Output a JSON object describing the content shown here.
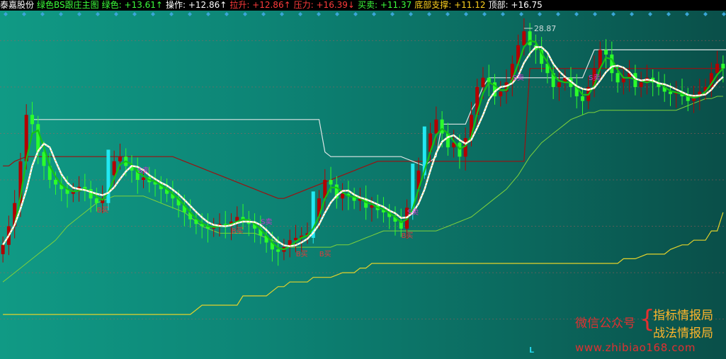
{
  "header": {
    "stock_name": "泰嘉股份",
    "indicator_name": "绿色BS跟庄主图",
    "readouts": [
      {
        "label": "绿色:",
        "value": "+13.61",
        "arrow": "↑",
        "color": "#3cff3c"
      },
      {
        "label": "操作:",
        "value": "+12.86",
        "arrow": "↑",
        "color": "#ffffff"
      },
      {
        "label": "拉升:",
        "value": "+12.86",
        "arrow": "↑",
        "color": "#ff3b3b"
      },
      {
        "label": "压力:",
        "value": "+16.39",
        "arrow": "↓",
        "color": "#ff3b3b"
      },
      {
        "label": "买卖:",
        "value": "+11.37",
        "arrow": "",
        "color": "#3cff3c"
      },
      {
        "label": "底部支撑:",
        "value": "+11.12",
        "arrow": "",
        "color": "#ffd21e"
      },
      {
        "label": "顶部:",
        "value": "+16.75",
        "arrow": "",
        "color": "#ffffff"
      }
    ]
  },
  "chart_data": {
    "type": "candlestick",
    "ylim": [
      10.4,
      17.6
    ],
    "grid": true,
    "max_annotation": "28.87",
    "colors": {
      "up_bar": "#b30000",
      "down_bar": "#2bff2b",
      "signal_bar": "#22e8f2",
      "pressure": "#9a1111",
      "top": "#dfe6e6",
      "support": "#e3d22b",
      "lower_band": "#7fd13b",
      "ma_white": "#ffffff",
      "ma_green": "#16c216",
      "signal_label": "#e03b3b",
      "sell_label": "#cc33cc"
    },
    "closes": [
      12.6,
      13.0,
      13.5,
      14.4,
      15.4,
      15.2,
      14.6,
      14.3,
      14.0,
      13.9,
      13.8,
      13.7,
      13.75,
      13.85,
      13.8,
      13.6,
      13.5,
      13.6,
      14.1,
      14.4,
      14.5,
      14.3,
      14.2,
      14.0,
      14.05,
      13.95,
      13.9,
      13.8,
      13.7,
      13.6,
      13.45,
      13.3,
      13.15,
      13.05,
      13.0,
      12.95,
      13.0,
      13.05,
      13.0,
      13.1,
      13.2,
      13.15,
      13.05,
      12.95,
      12.8,
      12.65,
      12.5,
      12.45,
      12.55,
      12.7,
      12.75,
      12.8,
      12.85,
      13.2,
      13.6,
      14.0,
      13.9,
      13.6,
      13.7,
      13.65,
      13.55,
      13.6,
      13.4,
      13.45,
      13.35,
      13.3,
      13.2,
      13.1,
      12.95,
      13.4,
      13.8,
      14.2,
      14.6,
      15.0,
      15.3,
      15.0,
      14.7,
      14.8,
      14.5,
      14.9,
      15.4,
      16.0,
      16.2,
      16.1,
      15.8,
      15.9,
      16.1,
      16.5,
      16.9,
      17.2,
      16.9,
      16.8,
      16.5,
      16.3,
      16.0,
      16.1,
      16.2,
      16.0,
      15.8,
      15.7,
      16.0,
      16.4,
      16.8,
      16.7,
      16.3,
      16.1,
      16.2,
      16.3,
      16.0,
      16.1,
      16.2,
      16.1,
      16.0,
      15.9,
      15.85,
      15.9,
      15.8,
      15.7,
      15.8,
      15.9,
      16.0,
      16.3,
      16.5,
      16.4
    ],
    "pressure": [
      14.3,
      14.3,
      14.4,
      14.45,
      14.5,
      14.5,
      14.5,
      14.5,
      14.5,
      14.5,
      14.5,
      14.5,
      14.5,
      14.5,
      14.5,
      14.5,
      14.5,
      14.5,
      14.5,
      14.5,
      14.5,
      14.5,
      14.5,
      14.5,
      14.5,
      14.5,
      14.5,
      14.5,
      14.5,
      14.5,
      14.45,
      14.4,
      14.35,
      14.3,
      14.25,
      14.2,
      14.15,
      14.1,
      14.05,
      14.0,
      13.95,
      13.9,
      13.85,
      13.8,
      13.75,
      13.7,
      13.65,
      13.6,
      13.6,
      13.65,
      13.7,
      13.75,
      13.8,
      13.85,
      13.9,
      13.95,
      14.0,
      14.05,
      14.1,
      14.15,
      14.2,
      14.25,
      14.3,
      14.35,
      14.4,
      14.4,
      14.4,
      14.4,
      14.4,
      14.4,
      14.4,
      14.4,
      14.4,
      14.4,
      14.4,
      14.4,
      14.4,
      14.4,
      14.4,
      14.4,
      14.4,
      14.4,
      14.4,
      14.4,
      14.4,
      14.4,
      14.4,
      14.4,
      14.4,
      14.4,
      16.4,
      16.4,
      16.4,
      16.4,
      16.4,
      16.4,
      16.4,
      16.4,
      16.4,
      16.4,
      16.4,
      16.4,
      16.4,
      16.4,
      16.4,
      16.4,
      16.4,
      16.4,
      16.4,
      16.4,
      16.4,
      16.4,
      16.4,
      16.4,
      16.4,
      16.4,
      16.4,
      16.4,
      16.4,
      16.4,
      16.4,
      16.4,
      16.4,
      16.4
    ],
    "top": [
      null,
      null,
      null,
      null,
      null,
      15.3,
      15.3,
      15.3,
      15.3,
      15.3,
      15.3,
      15.3,
      15.3,
      15.3,
      15.3,
      15.3,
      15.3,
      15.3,
      15.3,
      15.3,
      15.3,
      15.3,
      15.3,
      15.3,
      15.3,
      15.3,
      15.3,
      15.3,
      15.3,
      15.3,
      15.3,
      15.3,
      15.3,
      15.3,
      15.3,
      15.3,
      15.3,
      15.3,
      15.3,
      15.3,
      15.3,
      15.3,
      15.3,
      15.3,
      15.3,
      15.3,
      15.3,
      15.3,
      15.3,
      15.3,
      15.3,
      15.3,
      15.3,
      15.3,
      15.3,
      14.6,
      14.5,
      14.5,
      14.5,
      14.5,
      14.5,
      14.5,
      14.5,
      14.5,
      14.5,
      14.5,
      14.5,
      14.5,
      14.5,
      14.45,
      14.4,
      14.35,
      14.3,
      14.4,
      14.5,
      15.2,
      15.2,
      15.2,
      15.2,
      15.2,
      15.5,
      15.7,
      16.0,
      16.2,
      16.2,
      16.2,
      16.2,
      16.2,
      16.2,
      16.2,
      16.2,
      16.2,
      16.2,
      16.2,
      16.2,
      16.2,
      16.2,
      16.2,
      16.2,
      16.2,
      16.5,
      16.8,
      16.8,
      16.8,
      16.8,
      16.8,
      16.8,
      16.8,
      16.8,
      16.8,
      16.8,
      16.8,
      16.8,
      16.8,
      16.8,
      16.8,
      16.8,
      16.8,
      16.8,
      16.8,
      16.8,
      16.8,
      16.8,
      16.8,
      16.8,
      16.8,
      16.8,
      16.8
    ],
    "support": [
      11.1,
      11.1,
      11.1,
      11.1,
      11.1,
      11.1,
      11.1,
      11.1,
      11.1,
      11.1,
      11.1,
      11.1,
      11.1,
      11.1,
      11.1,
      11.1,
      11.1,
      11.1,
      11.1,
      11.1,
      11.1,
      11.1,
      11.1,
      11.1,
      11.1,
      11.1,
      11.1,
      11.1,
      11.1,
      11.1,
      11.1,
      11.1,
      11.1,
      11.2,
      11.3,
      11.3,
      11.3,
      11.3,
      11.3,
      11.3,
      11.3,
      11.5,
      11.5,
      11.5,
      11.5,
      11.5,
      11.6,
      11.7,
      11.7,
      11.8,
      11.8,
      11.8,
      11.8,
      11.9,
      11.9,
      11.9,
      11.9,
      11.95,
      12.0,
      12.0,
      12.0,
      12.1,
      12.1,
      12.2,
      12.2,
      12.2,
      12.2,
      12.2,
      12.2,
      12.2,
      12.2,
      12.2,
      12.2,
      12.2,
      12.2,
      12.2,
      12.2,
      12.2,
      12.2,
      12.2,
      12.2,
      12.2,
      12.2,
      12.2,
      12.2,
      12.2,
      12.2,
      12.2,
      12.2,
      12.2,
      12.2,
      12.2,
      12.2,
      12.2,
      12.2,
      12.2,
      12.2,
      12.2,
      12.2,
      12.2,
      12.2,
      12.2,
      12.2,
      12.2,
      12.2,
      12.2,
      12.3,
      12.3,
      12.3,
      12.35,
      12.4,
      12.4,
      12.4,
      12.4,
      12.5,
      12.55,
      12.6,
      12.6,
      12.7,
      12.7,
      12.7,
      12.9,
      12.9,
      13.3
    ],
    "lower_band": [
      11.8,
      11.9,
      12.0,
      12.1,
      12.2,
      12.3,
      12.4,
      12.5,
      12.6,
      12.7,
      12.85,
      13.0,
      13.1,
      13.2,
      13.3,
      13.4,
      13.5,
      13.55,
      13.6,
      13.65,
      13.65,
      13.65,
      13.65,
      13.65,
      13.65,
      13.6,
      13.55,
      13.5,
      13.45,
      13.4,
      13.35,
      13.3,
      13.2,
      13.1,
      13.0,
      12.95,
      12.9,
      12.85,
      12.85,
      12.85,
      12.85,
      12.85,
      12.85,
      12.85,
      12.8,
      12.75,
      12.7,
      12.65,
      12.6,
      12.55,
      12.55,
      12.55,
      12.55,
      12.55,
      12.55,
      12.55,
      12.55,
      12.6,
      12.6,
      12.6,
      12.65,
      12.7,
      12.75,
      12.8,
      12.85,
      12.9,
      12.9,
      12.9,
      12.9,
      12.9,
      12.9,
      12.9,
      12.9,
      12.9,
      12.9,
      12.95,
      13.0,
      13.05,
      13.1,
      13.15,
      13.2,
      13.3,
      13.4,
      13.5,
      13.6,
      13.7,
      13.8,
      13.95,
      14.1,
      14.3,
      14.5,
      14.65,
      14.8,
      14.9,
      15.0,
      15.1,
      15.2,
      15.3,
      15.35,
      15.4,
      15.45,
      15.45,
      15.5,
      15.5,
      15.5,
      15.5,
      15.5,
      15.5,
      15.5,
      15.5,
      15.5,
      15.5,
      15.5,
      15.5,
      15.5,
      15.5,
      15.55,
      15.6,
      15.65,
      15.7,
      15.75,
      15.75,
      15.8,
      15.8
    ],
    "signal_bars": [
      18,
      53,
      70,
      72
    ],
    "signal_labels": [
      {
        "text": "B买",
        "index": 17,
        "value": 13.3
      },
      {
        "text": "B买",
        "index": 40,
        "value": 12.85
      },
      {
        "text": "B买",
        "index": 51,
        "value": 12.35
      },
      {
        "text": "B买",
        "index": 55,
        "value": 12.35
      },
      {
        "text": "B买",
        "index": 69,
        "value": 12.75
      }
    ],
    "sell_labels": [
      {
        "text": "S卖",
        "index": 24,
        "value": 14.15
      },
      {
        "text": "S卖",
        "index": 45,
        "value": 13.05
      },
      {
        "text": "S卖",
        "index": 70,
        "value": 13.25
      },
      {
        "text": "S卖",
        "index": 88,
        "value": 16.15
      },
      {
        "text": "S卖",
        "index": 101,
        "value": 16.15
      }
    ]
  },
  "watermark": {
    "wechat_label": "微信公众号",
    "brace": "{",
    "line1": "指标情报局",
    "line2": "战法情报局",
    "url": "www.zhibiao168.com",
    "colors": {
      "wechat": "#e23030",
      "brace": "#e23030",
      "lines": "#ffb52b",
      "url": "#e23030"
    }
  },
  "cursor_label": "L"
}
